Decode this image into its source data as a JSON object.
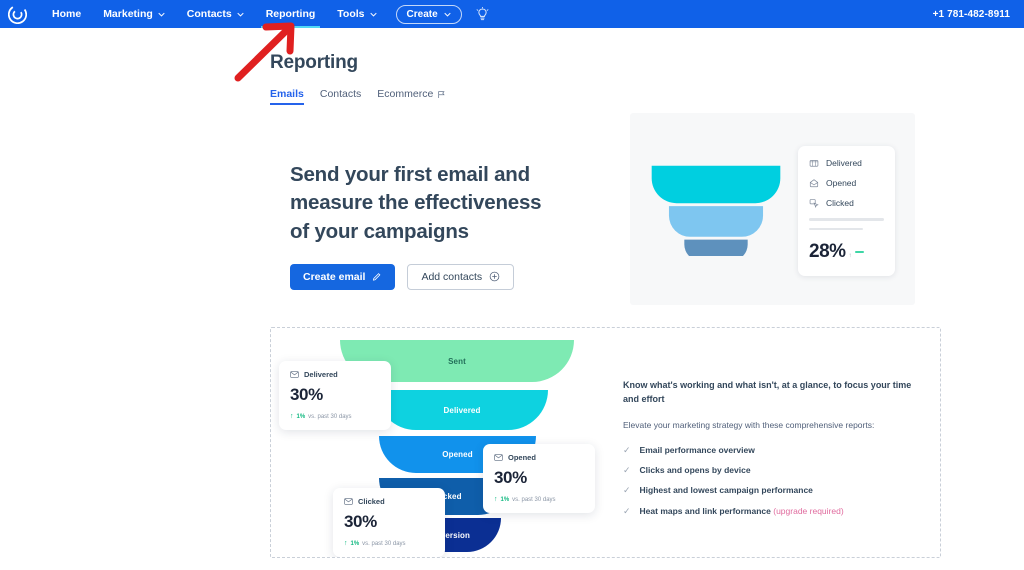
{
  "topnav": {
    "logo_icon": "constant-contact-logo-icon",
    "items": [
      {
        "label": "Home",
        "has_caret": false,
        "active": false
      },
      {
        "label": "Marketing",
        "has_caret": true,
        "active": false
      },
      {
        "label": "Contacts",
        "has_caret": true,
        "active": false
      },
      {
        "label": "Reporting",
        "has_caret": false,
        "active": true
      },
      {
        "label": "Tools",
        "has_caret": true,
        "active": false
      }
    ],
    "create_label": "Create",
    "bulb_icon": "lightbulb-icon",
    "phone": "+1 781-482-8911"
  },
  "page": {
    "title": "Reporting",
    "tabs": [
      {
        "label": "Emails",
        "active": true,
        "icon": ""
      },
      {
        "label": "Contacts",
        "active": false,
        "icon": ""
      },
      {
        "label": "Ecommerce",
        "active": false,
        "icon": "flag-icon"
      }
    ]
  },
  "hero": {
    "headline": "Send your first email and measure the effectiveness of your campaigns",
    "primary_button": "Create email",
    "primary_icon": "pencil-icon",
    "secondary_button": "Add contacts",
    "secondary_icon": "plus-circle-icon",
    "card": {
      "rows": [
        {
          "label": "Delivered",
          "icon": "delivered-icon"
        },
        {
          "label": "Opened",
          "icon": "opened-envelope-icon"
        },
        {
          "label": "Clicked",
          "icon": "click-cursor-icon"
        }
      ],
      "percent": "28%",
      "tick": "↑"
    },
    "funnel_colors": [
      "#00cfe0",
      "#7ec6f0",
      "#5e91bd"
    ]
  },
  "report_preview": {
    "funnel": [
      {
        "label": "Sent",
        "color": "#7eeab3"
      },
      {
        "label": "Delivered",
        "color": "#0ed2e0"
      },
      {
        "label": "Opened",
        "color": "#1192ec"
      },
      {
        "label": "Clicked",
        "color": "#0f5eaa"
      },
      {
        "label": "Conversion",
        "color": "#0b2f93"
      }
    ],
    "cards": [
      {
        "title": "Delivered",
        "icon": "envelope-icon",
        "percent": "30%",
        "arrow": "↑",
        "delta": "1%",
        "period": "vs. past 30 days"
      },
      {
        "title": "Opened",
        "icon": "envelope-icon",
        "percent": "30%",
        "arrow": "↑",
        "delta": "1%",
        "period": "vs. past 30 days"
      },
      {
        "title": "Clicked",
        "icon": "envelope-icon",
        "percent": "30%",
        "arrow": "↑",
        "delta": "1%",
        "period": "vs. past 30 days"
      }
    ],
    "copy": {
      "heading": "Know what's working and what isn't, at a glance, to focus your time and effort",
      "subheading": "Elevate your marketing strategy with these comprehensive reports:",
      "features": [
        {
          "text": "Email performance overview",
          "note": ""
        },
        {
          "text": "Clicks and opens by device",
          "note": ""
        },
        {
          "text": "Highest and lowest campaign performance",
          "note": ""
        },
        {
          "text": "Heat maps and link performance",
          "note": "(upgrade required)"
        }
      ]
    }
  },
  "annotation": {
    "type": "red-arrow",
    "points_to": "Tools",
    "color": "#e02020"
  },
  "colors": {
    "nav_blue": "#1061e8",
    "accent_blue": "#2563eb",
    "active_underline": "#52d9f5",
    "text": "#33475b",
    "upgrade_pink": "#e06b9e",
    "green": "#12b981"
  }
}
